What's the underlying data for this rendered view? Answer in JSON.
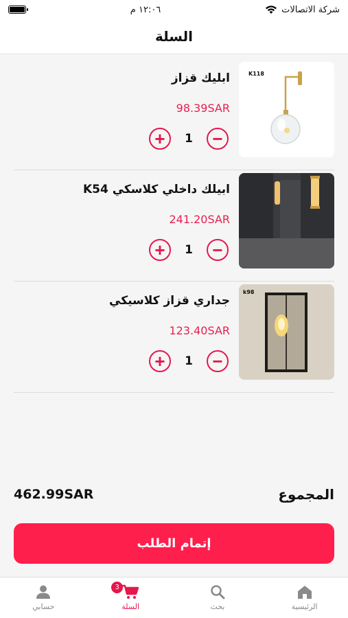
{
  "status_bar": {
    "carrier": "شركة الاتصالات",
    "time": "١٢:٠٦ م"
  },
  "header": {
    "title": "السلة"
  },
  "cart": {
    "items": [
      {
        "title": "ابليك قزاز",
        "price": "98.39SAR",
        "quantity": "1",
        "image_label": "K118"
      },
      {
        "title": "ابيلك داخلي كلاسكي K54",
        "price": "241.20SAR",
        "quantity": "1",
        "image_label": ""
      },
      {
        "title": "جداري قزاز كلاسيكي",
        "price": "123.40SAR",
        "quantity": "1",
        "image_label": "k98"
      }
    ],
    "increment_symbol": "+",
    "decrement_symbol": "−"
  },
  "total": {
    "label": "المجموع",
    "value": "462.99SAR"
  },
  "checkout": {
    "label": "إتمام الطلب"
  },
  "tab_bar": {
    "tabs": [
      {
        "label": "حسابي",
        "icon": "user-icon"
      },
      {
        "label": "السلة",
        "icon": "cart-icon",
        "badge": "3"
      },
      {
        "label": "بحث",
        "icon": "search-icon"
      },
      {
        "label": "الرئيسية",
        "icon": "home-icon"
      }
    ],
    "active_color": "#e5174d"
  },
  "colors": {
    "accent": "#ff1f4d",
    "price": "#e91e50"
  }
}
